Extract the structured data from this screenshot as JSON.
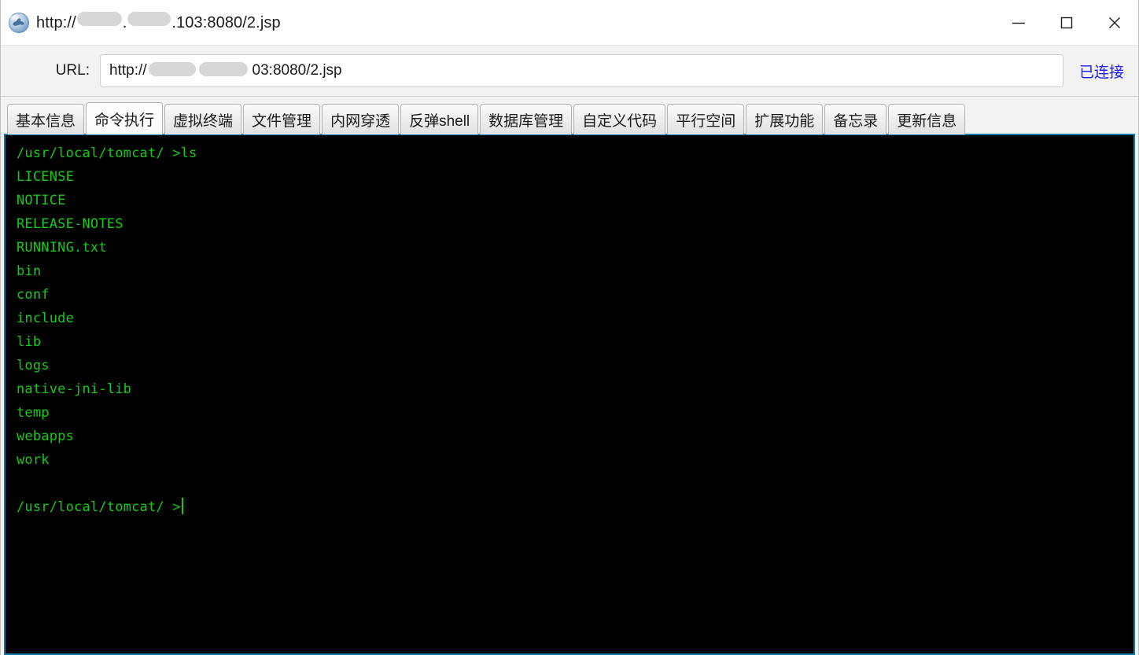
{
  "window": {
    "title_prefix": "http://",
    "title_suffix": ".103:8080/2.jsp",
    "app_icon": "behinder-globe-icon",
    "controls": {
      "minimize": "minimize-icon",
      "maximize": "maximize-icon",
      "close": "close-icon"
    }
  },
  "urlbar": {
    "label": "URL:",
    "value_prefix": "http://",
    "value_suffix": "03:8080/2.jsp",
    "status": "已连接",
    "status_color": "#1a1aff"
  },
  "tabs": [
    {
      "label": "基本信息",
      "active": false
    },
    {
      "label": "命令执行",
      "active": true
    },
    {
      "label": "虚拟终端",
      "active": false
    },
    {
      "label": "文件管理",
      "active": false
    },
    {
      "label": "内网穿透",
      "active": false
    },
    {
      "label": "反弹shell",
      "active": false
    },
    {
      "label": "数据库管理",
      "active": false
    },
    {
      "label": "自定义代码",
      "active": false
    },
    {
      "label": "平行空间",
      "active": false
    },
    {
      "label": "扩展功能",
      "active": false
    },
    {
      "label": "备忘录",
      "active": false
    },
    {
      "label": "更新信息",
      "active": false
    }
  ],
  "terminal": {
    "foreground": "#13cc13",
    "background": "#000000",
    "border_color": "#1278a8",
    "prompt": "/usr/local/tomcat/ >",
    "lines": [
      "/usr/local/tomcat/ >ls",
      "LICENSE",
      "NOTICE",
      "RELEASE-NOTES",
      "RUNNING.txt",
      "bin",
      "conf",
      "include",
      "lib",
      "logs",
      "native-jni-lib",
      "temp",
      "webapps",
      "work",
      ""
    ],
    "current_prompt_line": "/usr/local/tomcat/ >"
  }
}
